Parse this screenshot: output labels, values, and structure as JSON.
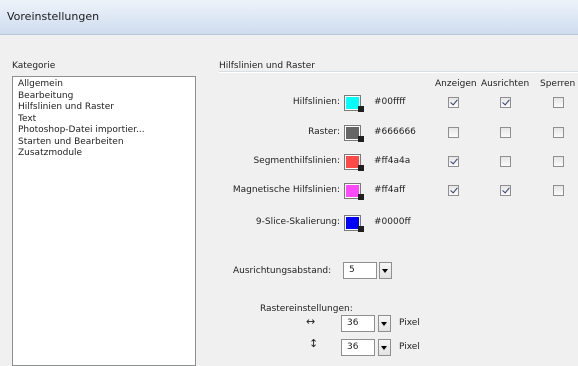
{
  "window": {
    "title": "Voreinstellungen"
  },
  "category_label": "Kategorie",
  "categories": [
    "Allgemein",
    "Bearbeitung",
    "Hilfslinien und Raster",
    "Text",
    "Photoshop-Datei importier...",
    "Starten und Bearbeiten",
    "Zusatzmodule"
  ],
  "section_title": "Hilfslinien und Raster",
  "columns": [
    "Anzeigen",
    "Ausrichten",
    "Sperren"
  ],
  "rows": [
    {
      "label": "Hilfslinien:",
      "hex": "#00ffff",
      "color": "#00ffff",
      "anzeigen": true,
      "ausrichten": true,
      "sperren": false
    },
    {
      "label": "Raster:",
      "hex": "#666666",
      "color": "#666666",
      "anzeigen": false,
      "ausrichten": false,
      "sperren": false
    },
    {
      "label": "Segmenthilfslinien:",
      "hex": "#ff4a4a",
      "color": "#ff4a4a",
      "anzeigen": true,
      "ausrichten": false,
      "sperren": false
    },
    {
      "label": "Magnetische Hilfslinien:",
      "hex": "#ff4aff",
      "color": "#ff4aff",
      "anzeigen": true,
      "ausrichten": true,
      "sperren": false
    },
    {
      "label": "9-Slice-Skalierung:",
      "hex": "#0000ff",
      "color": "#0000ff"
    }
  ],
  "snap_distance": {
    "label": "Ausrichtungsabstand:",
    "value": "5"
  },
  "grid_settings": {
    "label": "Rastereinstellungen:",
    "horizontal": {
      "icon": "↔",
      "value": "36",
      "unit": "Pixel"
    },
    "vertical": {
      "icon": "↕",
      "value": "36",
      "unit": "Pixel"
    }
  }
}
